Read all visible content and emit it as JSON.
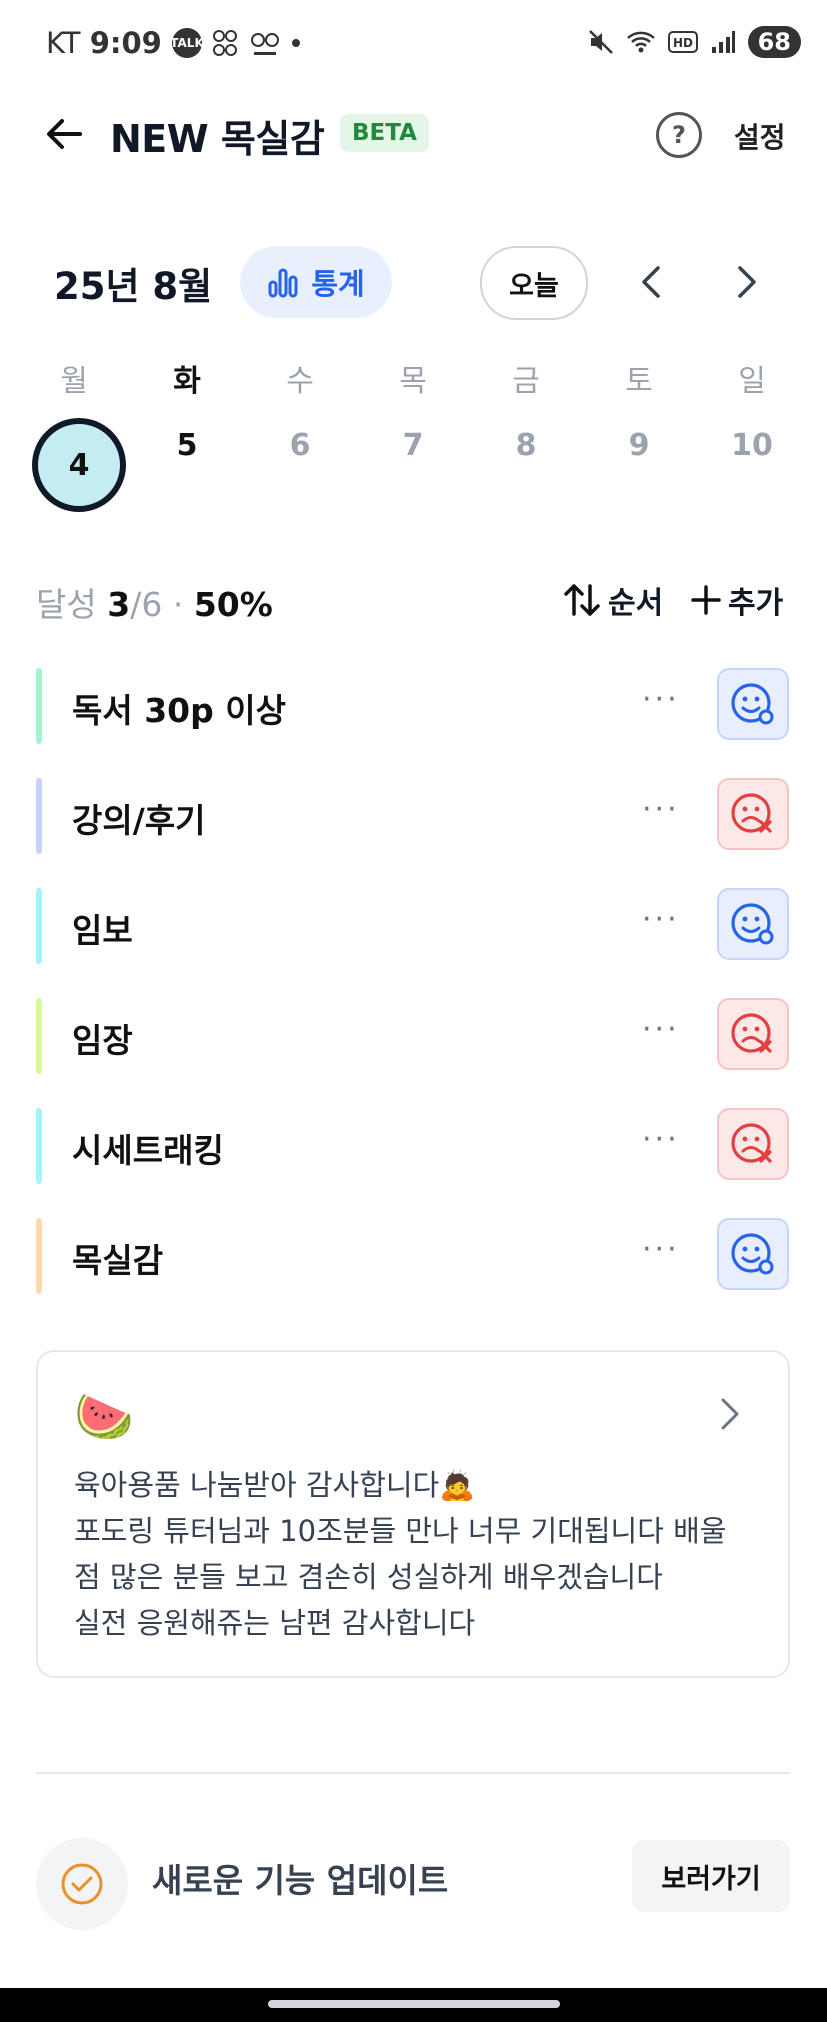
{
  "status_bar": {
    "carrier": "KT",
    "time": "9:09",
    "battery": "68",
    "talk": "TALK"
  },
  "header": {
    "title": "NEW 목실감",
    "badge": "BETA",
    "settings": "설정",
    "help_glyph": "?"
  },
  "calendar": {
    "month": "25년 8월",
    "stats_label": "통계",
    "today_label": "오늘",
    "weekdays": [
      "월",
      "화",
      "수",
      "목",
      "금",
      "토",
      "일"
    ],
    "dates": [
      "4",
      "5",
      "6",
      "7",
      "8",
      "9",
      "10"
    ]
  },
  "summary": {
    "label": "달성",
    "done": "3",
    "total": "/6",
    "dot": "·",
    "percent": "50%",
    "sort": "순서",
    "add": "추가"
  },
  "habits": [
    {
      "name": "독서 30p 이상",
      "done": true,
      "bar_color": "#a7f3d0"
    },
    {
      "name": "강의/후기",
      "done": false,
      "bar_color": "#c7d2fe"
    },
    {
      "name": "임보",
      "done": true,
      "bar_color": "#a5f3fc"
    },
    {
      "name": "임장",
      "done": false,
      "bar_color": "#d9f99d"
    },
    {
      "name": "시세트래킹",
      "done": false,
      "bar_color": "#a5f3fc"
    },
    {
      "name": "목실감",
      "done": true,
      "bar_color": "#fed7aa"
    }
  ],
  "memo": {
    "emoji": "🍉",
    "lines": [
      "육아용품 나눔받아 감사합니다🙇",
      "포도링 튜터님과 10조분들 만나 너무 기대됩니다 배울",
      "점 많은 분들 보고 겸손히 성실하게 배우겠습니다",
      "실전 응원해쥬는 남편 감사합니다"
    ]
  },
  "update": {
    "text": "새로운 기능 업데이트",
    "button": "보러가기"
  },
  "colors": {
    "accent": "#2463eb",
    "ok": "#2463eb",
    "fail": "#e53e3e",
    "orange": "#e8902a"
  }
}
